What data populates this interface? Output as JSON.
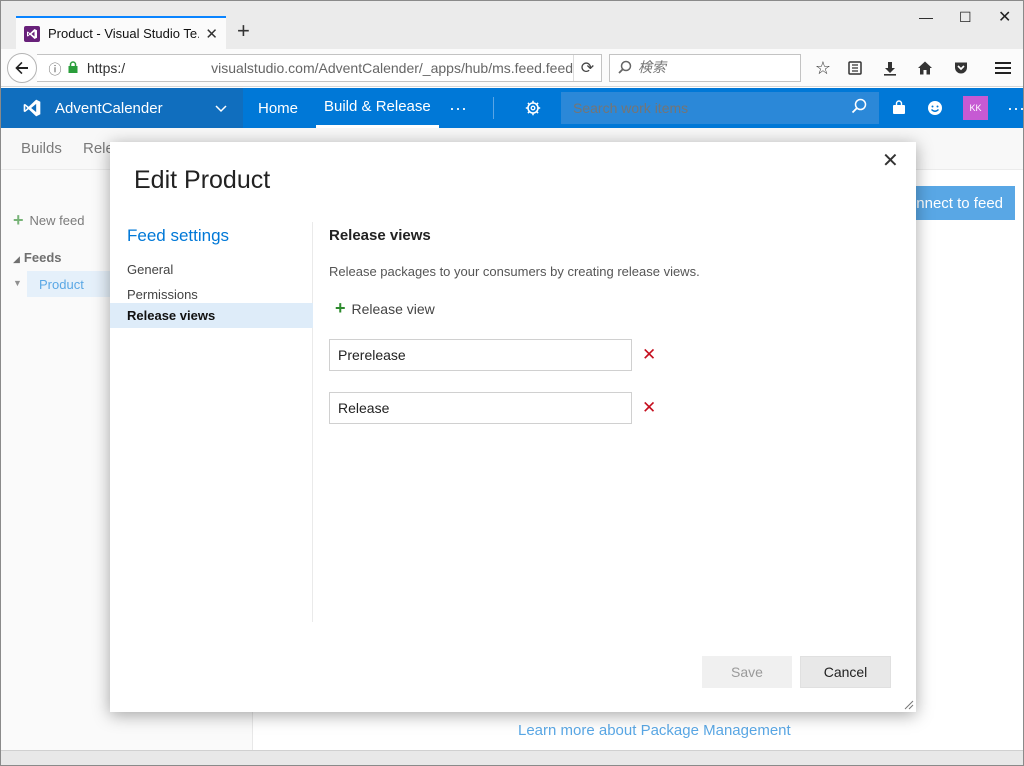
{
  "browser": {
    "tab_title": "Product - Visual Studio Te...",
    "url_scheme": "https:/",
    "url_rest": "visualstudio.com/AdventCalender/_apps/hub/ms.feed.feed-",
    "search_placeholder": "検索"
  },
  "vsts": {
    "account": "AdventCalender",
    "nav": [
      "Home",
      "Build & Release"
    ],
    "search_placeholder": "Search work items",
    "avatar_initials": "KK",
    "accent_color": "#0078d7"
  },
  "page": {
    "subnav": [
      "Builds",
      "Relea"
    ],
    "new_feed": "New feed",
    "feeds_header": "Feeds",
    "selected_feed": "Product",
    "connect_button": "nnect to feed",
    "learn_more": "Learn more about Package Management"
  },
  "modal": {
    "title": "Edit Product",
    "sidebar_header": "Feed settings",
    "sidebar_items": [
      "General",
      "Permissions",
      "Release views"
    ],
    "content_header": "Release views",
    "description": "Release packages to your consumers by creating release views.",
    "add_label": "Release view",
    "views": [
      "Prerelease",
      "Release"
    ],
    "save_label": "Save",
    "cancel_label": "Cancel"
  }
}
